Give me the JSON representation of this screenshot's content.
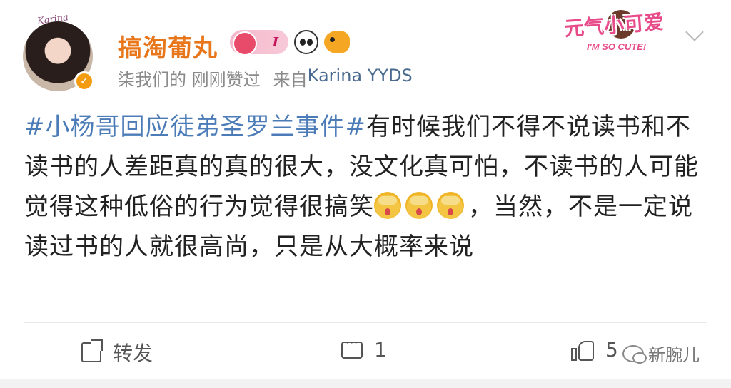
{
  "user": {
    "avatar_frame_text": "Karina",
    "name": "搞淘葡丸",
    "level": "I",
    "meta_action": "柒我们的 刚刚赞过",
    "meta_from": "来自",
    "meta_source": "Karina YYDS"
  },
  "sticker": {
    "title": "元气小可爱",
    "subtitle": "I'M SO CUTE!"
  },
  "post": {
    "hashtag": "#小杨哥回应徒弟圣罗兰事件#",
    "text_part1": "有时候我们不得不说读书和不读书的人差距真的真的很大，没文化真可怕，不读书的人可能觉得这种低俗的行为觉得很搞笑",
    "text_part2": "，当然，不是一定说读过书的人就很高尚，只是从大概率来说"
  },
  "actions": {
    "repost_label": "转发",
    "comment_count": "1",
    "like_count": "5"
  },
  "watermark": {
    "text": "新腕儿"
  },
  "icons": [
    "verified-icon",
    "berry-level-icon",
    "panda-icon",
    "fish-icon",
    "chevron-down-icon",
    "facepalm-emoji",
    "repost-icon",
    "comment-icon",
    "like-icon",
    "wechat-icon"
  ]
}
